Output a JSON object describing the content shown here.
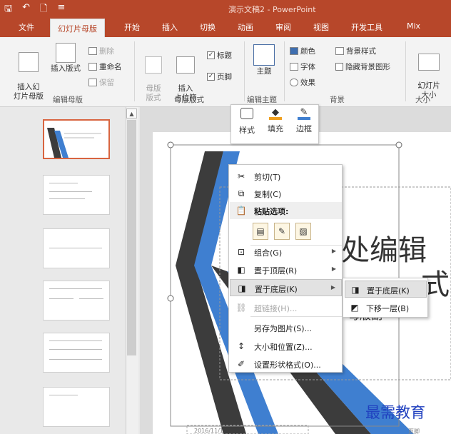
{
  "titlebar": {
    "doc_title": "演示文稿2 - PowerPoint",
    "qat": {
      "save_glyph": "🖫",
      "undo_glyph": "↶",
      "new_glyph": "🗋",
      "more_glyph": "≡"
    }
  },
  "tabs": [
    "文件",
    "幻灯片母版",
    "开始",
    "插入",
    "切换",
    "动画",
    "审阅",
    "视图",
    "开发工具",
    "Mix"
  ],
  "ribbon": {
    "edit_master": {
      "insert_master": "插入幻\n灯片母版",
      "insert_layout": "插入版式",
      "delete": "删除",
      "rename": "重命名",
      "preserve": "保留",
      "group_label": "编辑母版"
    },
    "master_layout": {
      "master_layout_btn": "母版\n版式",
      "insert_placeholder": "插入\n占位符",
      "title_check": "标题",
      "footer_check": "页脚",
      "group_label": "母版版式"
    },
    "edit_theme": {
      "theme_btn": "主题",
      "group_label": "编辑主题"
    },
    "background": {
      "colors": "颜色",
      "fonts": "字体",
      "effects": "效果",
      "bg_styles": "背景样式",
      "hide_bg": "隐藏背景图形",
      "group_label": "背景"
    },
    "size": {
      "slide_size": "幻灯片\n大小",
      "group_label": "大小"
    }
  },
  "minibar": {
    "style": "样式",
    "fill": "填充",
    "border": "边框"
  },
  "context_menu": {
    "cut": "剪切(T)",
    "copy": "复制(C)",
    "paste_options": "粘贴选项:",
    "group": "组合(G)",
    "bring_to_front": "置于顶层(R)",
    "send_to_back": "置于底层(K)",
    "hyperlink": "超链接(H)...",
    "save_as_picture": "另存为图片(S)...",
    "size_position": "大小和位置(Z)...",
    "format_shape": "设置形状格式(O)..."
  },
  "submenu": {
    "send_to_back": "置于底层(K)",
    "send_backward": "下移一层(B)"
  },
  "slide": {
    "title_fragment": "处编辑",
    "style_fragment": "式",
    "subtitle_fragment": "母版副",
    "date": "2016/11/1",
    "page": "页脚"
  },
  "watermark": "最需教育",
  "colors": {
    "accent": "#b7472a",
    "selection": "#d86540",
    "slide_blue": "#3f7fd0",
    "slide_dark": "#3c3c3c"
  }
}
